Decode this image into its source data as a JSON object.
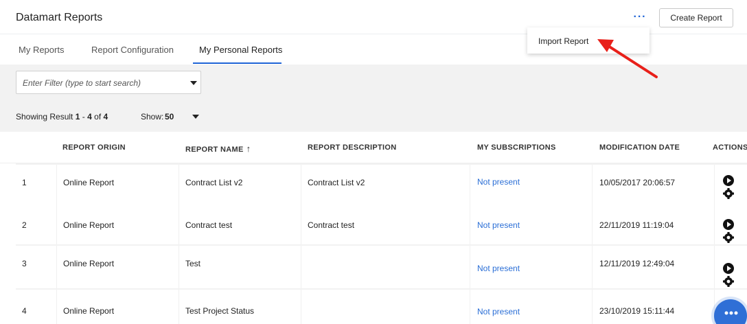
{
  "header": {
    "title": "Datamart Reports",
    "more_label": "···",
    "create_label": "Create Report"
  },
  "dropdown": {
    "items": [
      {
        "label": "Import Report"
      }
    ]
  },
  "tabs": [
    {
      "label": "My Reports",
      "active": false
    },
    {
      "label": "Report Configuration",
      "active": false
    },
    {
      "label": "My Personal Reports",
      "active": true
    }
  ],
  "filter": {
    "placeholder": "Enter Filter (type to start search)"
  },
  "results": {
    "prefix": "Showing Result",
    "from": "1",
    "sep": "-",
    "to": "4",
    "of_label": "of",
    "total": "4",
    "show_label": "Show:",
    "page_size": "50"
  },
  "table": {
    "columns": [
      "REPORT ORIGIN",
      "REPORT NAME",
      "REPORT DESCRIPTION",
      "MY SUBSCRIPTIONS",
      "MODIFICATION DATE",
      "ACTIONS"
    ],
    "sort_icon": "↑",
    "rows": [
      {
        "index": "1",
        "origin": "Online Report",
        "name": "Contract List v2",
        "description": "Contract List v2",
        "subscriptions": "Not present",
        "date": "10/05/2017 20:06:57"
      },
      {
        "index": "2",
        "origin": "Online Report",
        "name": "Contract test",
        "description": "Contract test",
        "subscriptions": "Not present",
        "date": "22/11/2019 11:19:04"
      },
      {
        "index": "3",
        "origin": "Online Report",
        "name": "Test",
        "description": "",
        "subscriptions": "Not present",
        "date": "12/11/2019 12:49:04"
      },
      {
        "index": "4",
        "origin": "Online Report",
        "name": "Test Project Status",
        "description": "",
        "subscriptions": "Not present",
        "date": "23/10/2019 15:11:44"
      }
    ]
  },
  "colors": {
    "accent": "#1e63d6",
    "link": "#2a6ed6",
    "annotation_arrow": "#e8201a"
  },
  "icons": {
    "more": "more-horizontal-icon",
    "play": "play-circle-icon",
    "settings": "gear-icon",
    "chat": "chat-icon"
  }
}
